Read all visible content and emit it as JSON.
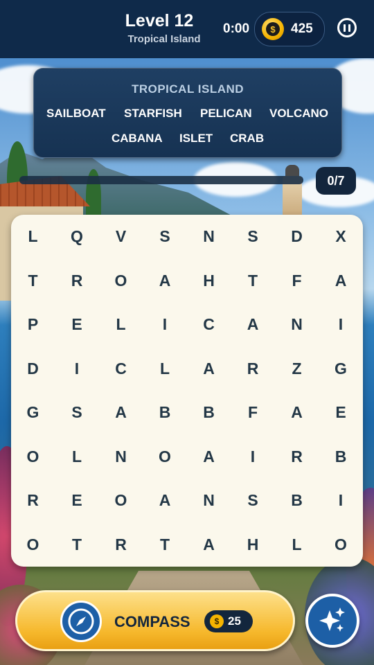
{
  "header": {
    "level_title": "Level 12",
    "level_subtitle": "Tropical Island",
    "timer": "0:00",
    "coins": "425",
    "coin_icon": "coin-icon",
    "pause_icon": "pause-icon"
  },
  "words_panel": {
    "title": "TROPICAL ISLAND",
    "words": [
      "SAILBOAT",
      "STARFISH",
      "PELICAN",
      "VOLCANO",
      "CABANA",
      "ISLET",
      "CRAB"
    ]
  },
  "progress": {
    "label": "0/7",
    "found": 0,
    "total": 7
  },
  "grid": {
    "rows": [
      [
        "L",
        "Q",
        "V",
        "S",
        "N",
        "S",
        "D",
        "X"
      ],
      [
        "T",
        "R",
        "O",
        "A",
        "H",
        "T",
        "F",
        "A"
      ],
      [
        "P",
        "E",
        "L",
        "I",
        "C",
        "A",
        "N",
        "I"
      ],
      [
        "D",
        "I",
        "C",
        "L",
        "A",
        "R",
        "Z",
        "G"
      ],
      [
        "G",
        "S",
        "A",
        "B",
        "B",
        "F",
        "A",
        "E"
      ],
      [
        "O",
        "L",
        "N",
        "O",
        "A",
        "I",
        "R",
        "B"
      ],
      [
        "R",
        "E",
        "O",
        "A",
        "N",
        "S",
        "B",
        "I"
      ],
      [
        "O",
        "T",
        "R",
        "T",
        "A",
        "H",
        "L",
        "O"
      ]
    ]
  },
  "compass_button": {
    "label": "COMPASS",
    "cost": "25",
    "icon": "compass-icon"
  },
  "magic_button": {
    "icon": "sparkles-icon"
  },
  "colors": {
    "header_bg": "#0f2a4a",
    "panel_bg": "#1f3f63",
    "grid_bg": "#fbf8ec",
    "letter": "#233746",
    "compass_button": "#f6b82c",
    "magic_button": "#1d5fa6"
  }
}
